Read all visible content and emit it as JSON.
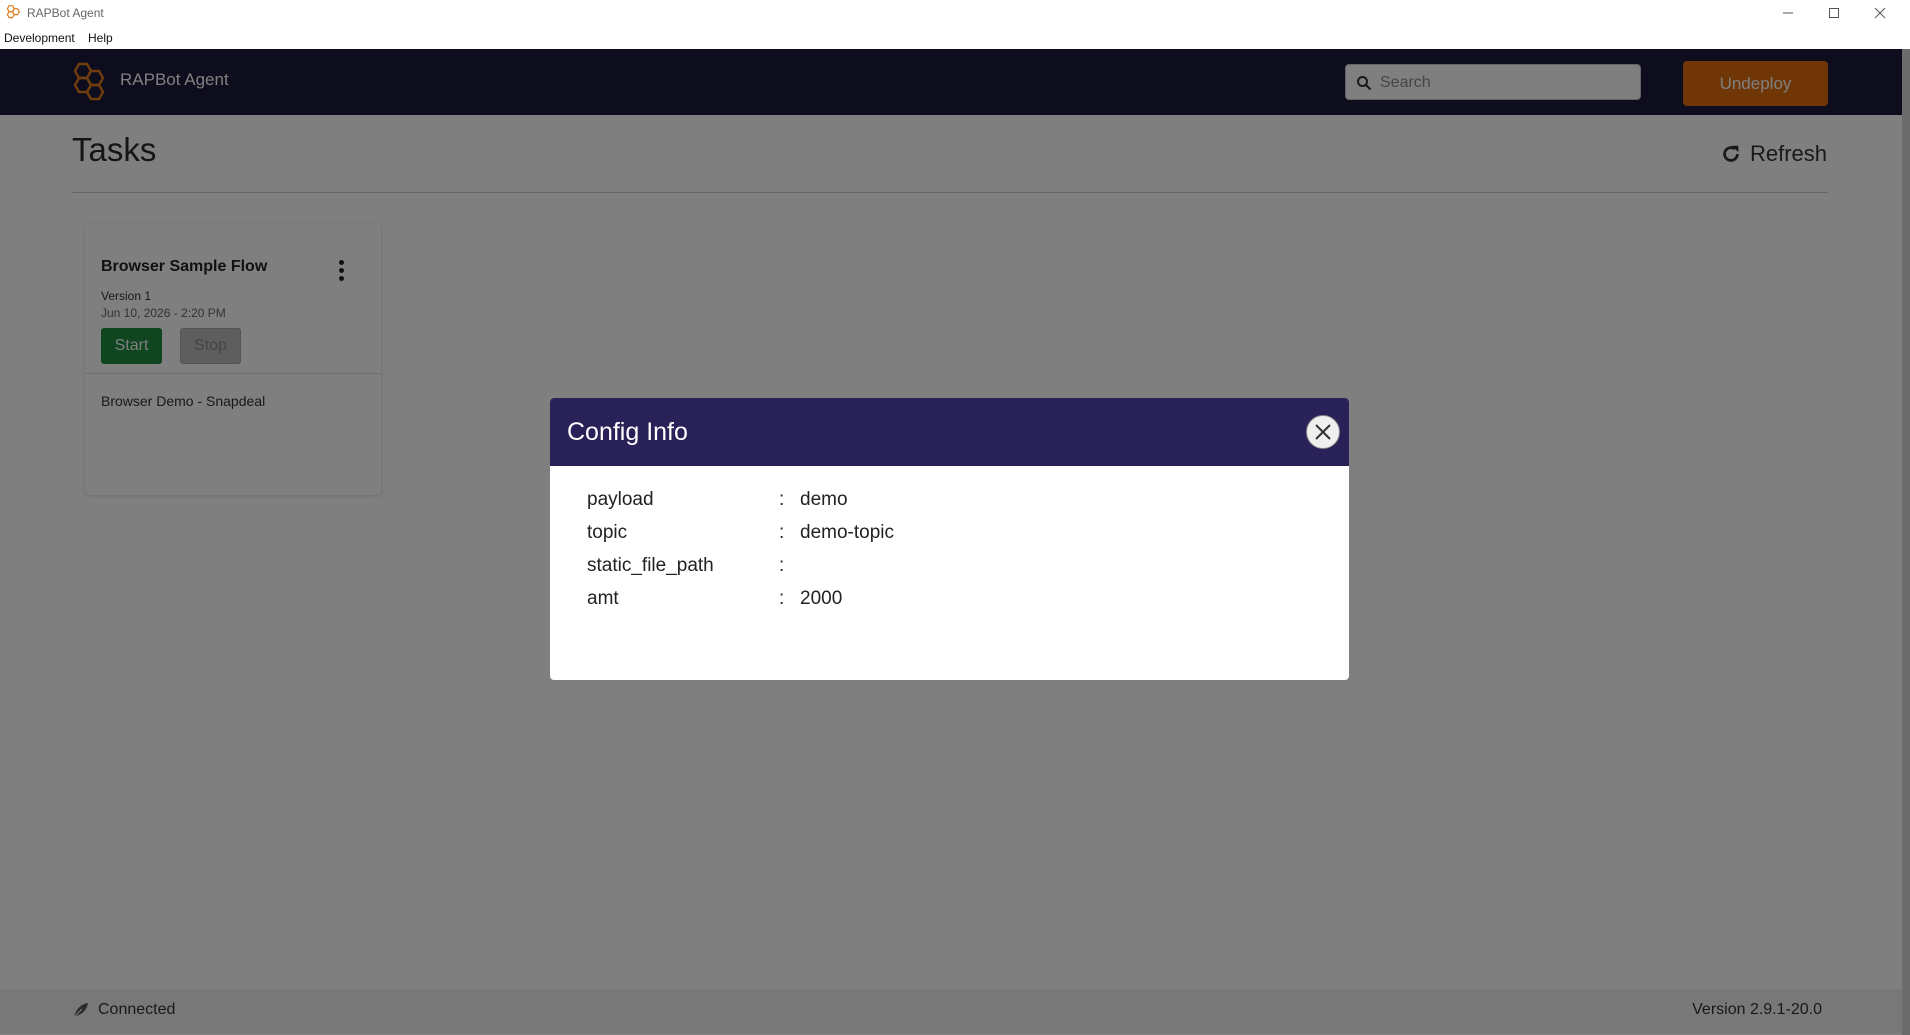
{
  "window": {
    "title": "RAPBot Agent"
  },
  "menu": [
    "Development",
    "Help"
  ],
  "header": {
    "brand": "RAPBot Agent",
    "search_placeholder": "Search",
    "undeploy_label": "Undeploy"
  },
  "page": {
    "title": "Tasks",
    "refresh_label": "Refresh"
  },
  "task_card": {
    "title": "Browser Sample Flow",
    "version": "Version 1",
    "date": "Jun 10, 2026 - 2:20 PM",
    "start_label": "Start",
    "stop_label": "Stop",
    "description": "Browser Demo - Snapdeal"
  },
  "footer": {
    "status": "Connected",
    "version": "Version 2.9.1-20.0"
  },
  "modal": {
    "title": "Config Info",
    "rows": [
      {
        "key": "payload",
        "value": "demo"
      },
      {
        "key": "topic",
        "value": "demo-topic"
      },
      {
        "key": "static_file_path",
        "value": ""
      },
      {
        "key": "amt",
        "value": "2000"
      }
    ]
  },
  "colors": {
    "header_bg": "#1c1a3d",
    "modal_header_bg": "#282258",
    "undeploy": "#e06c0c",
    "start": "#1e8a3e",
    "logo_accent": "#e07b1a"
  }
}
